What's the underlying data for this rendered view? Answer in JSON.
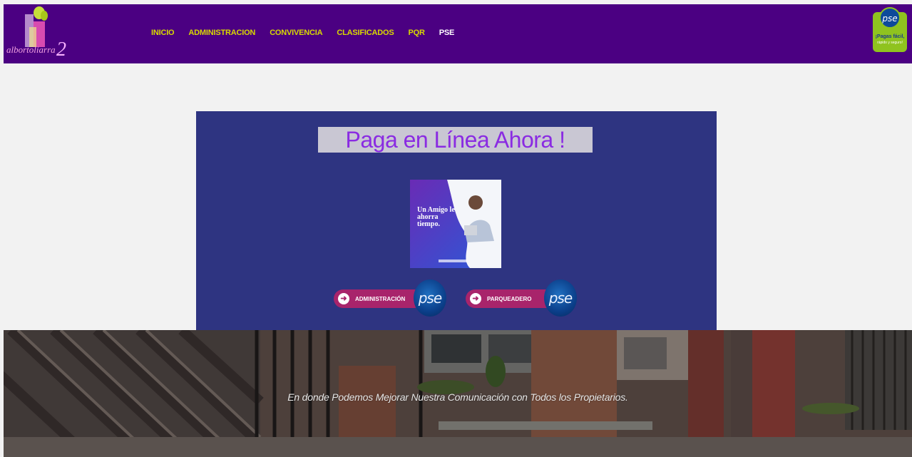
{
  "header": {
    "logo_icon": "community-logo",
    "nav": [
      {
        "label": "INICIO"
      },
      {
        "label": "ADMINISTRACION"
      },
      {
        "label": "CONVIVENCIA"
      },
      {
        "label": "CLASIFICADOS"
      },
      {
        "label": "PQR"
      },
      {
        "label": "PSE"
      }
    ],
    "active_nav": "PSE",
    "pse_badge": {
      "logo": "pse",
      "line1": "¡Pagas fácil,",
      "line2": "rápido y seguro!"
    }
  },
  "main": {
    "title": "Paga en Línea Ahora !",
    "promo": {
      "text": "Un Amigo le ahorra tiempo."
    },
    "buttons": [
      {
        "label": "ADMINISTRACIÓN",
        "logo": "pse"
      },
      {
        "label": "PARQUEADERO",
        "logo": "pse"
      }
    ]
  },
  "hero": {
    "caption": "En donde Podemos Mejorar Nuestra Comunicación con Todos los Propietarios."
  },
  "colors": {
    "header_bg": "#4b0082",
    "nav_link": "#d9d900",
    "panel_bg": "#2e3481",
    "title_color": "#8a2be2",
    "button_pill": "#a8246b"
  }
}
